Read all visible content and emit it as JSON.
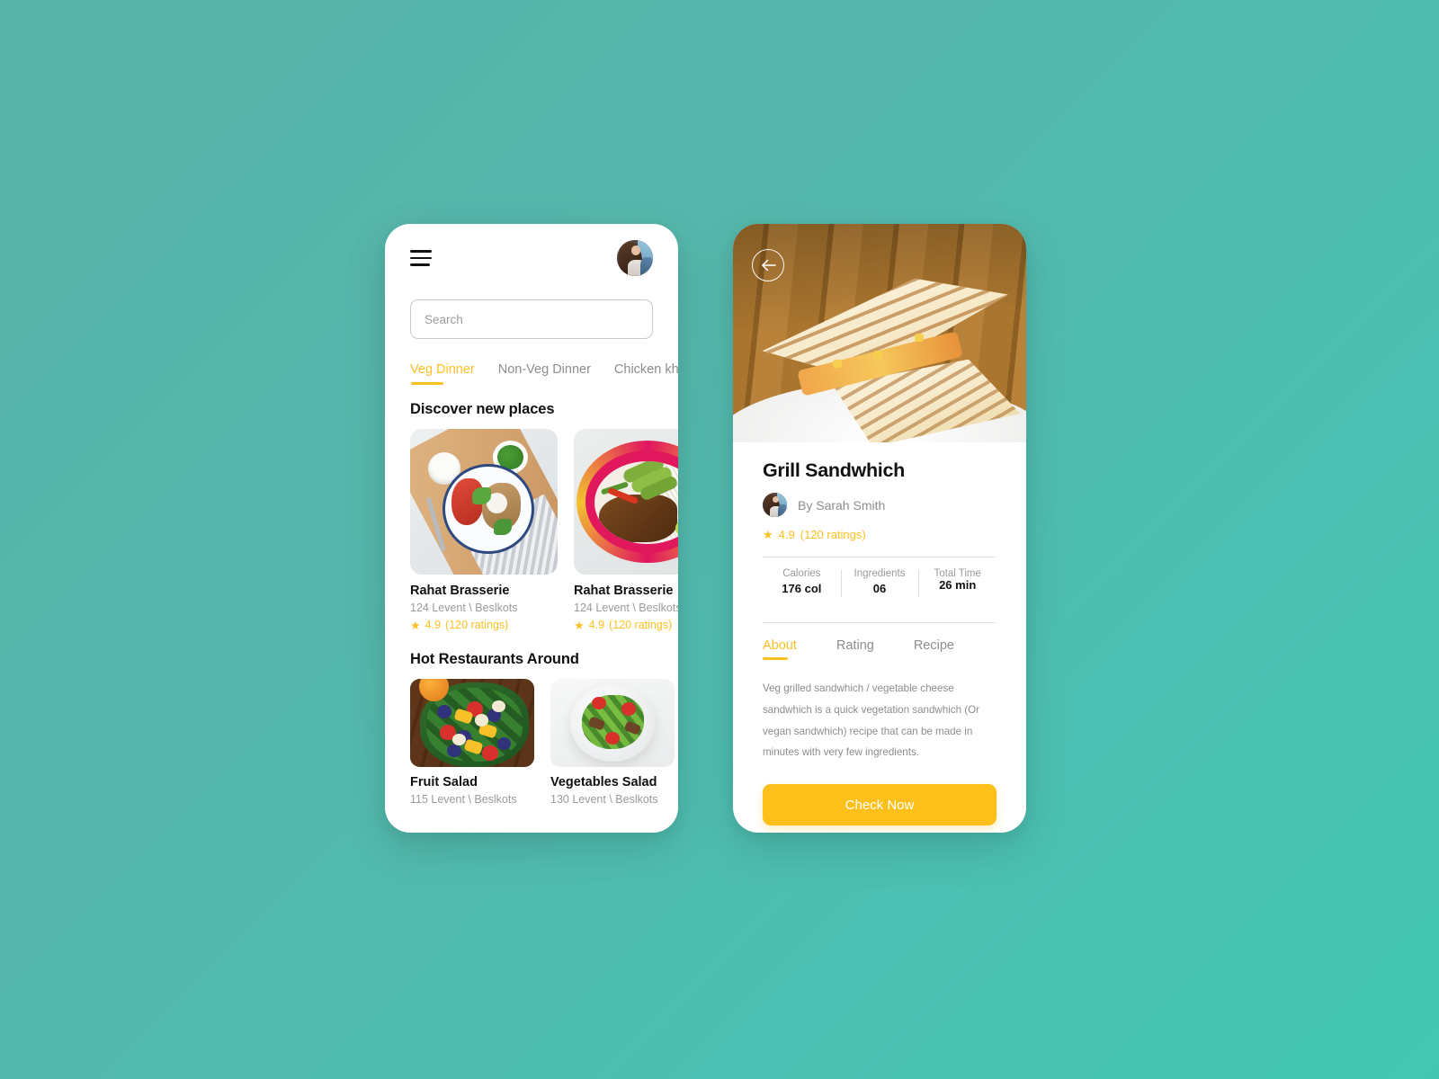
{
  "theme": {
    "background_teal": "#55b7ac",
    "accent_yellow": "#fdc024",
    "text_dark": "#111111",
    "text_muted": "#8d8d8d"
  },
  "left_phone": {
    "menu_icon": "hamburger-menu-icon",
    "avatar": "user-avatar",
    "search": {
      "placeholder": "Search",
      "value": ""
    },
    "category_tabs": [
      {
        "label": "Veg Dinner",
        "active": true
      },
      {
        "label": "Non-Veg Dinner",
        "active": false
      },
      {
        "label": "Chicken khe",
        "active": false
      }
    ],
    "discover": {
      "title": "Discover new places",
      "cards": [
        {
          "name": "Rahat Brasserie",
          "address": "124 Levent \\ Beslkots",
          "rating": "4.9",
          "ratings_count": "(120 ratings)"
        },
        {
          "name": "Rahat Brasserie",
          "address": "124 Levent \\ Beslkots",
          "rating": "4.9",
          "ratings_count": "(120 ratings)"
        }
      ]
    },
    "hot_restaurants": {
      "title": "Hot Restaurants Around",
      "cards": [
        {
          "name": "Fruit Salad",
          "address": "115 Levent \\ Beslkots"
        },
        {
          "name": "Vegetables Salad",
          "address": "130 Levent \\ Beslkots"
        }
      ]
    }
  },
  "right_phone": {
    "back_icon": "arrow-left-icon",
    "hero_image": "grilled-sandwich-photo",
    "title": "Grill Sandwhich",
    "author": "By Sarah Smith",
    "author_avatar": "author-avatar",
    "rating": "4.9",
    "ratings_count": "(120 ratings)",
    "stats": [
      {
        "label": "Calories",
        "value": "176 col"
      },
      {
        "label": "Ingredients",
        "value": "06"
      },
      {
        "label": "Total Time",
        "value": "26 min"
      }
    ],
    "detail_tabs": [
      {
        "label": "About",
        "active": true
      },
      {
        "label": "Rating",
        "active": false
      },
      {
        "label": "Recipe",
        "active": false
      }
    ],
    "description": "Veg grilled sandwhich / vegetable cheese sandwhich is a quick vegetation sandwhich (Or vegan sandwhich) recipe that can be made in minutes with very few ingredients.",
    "cta_label": "Check Now"
  }
}
